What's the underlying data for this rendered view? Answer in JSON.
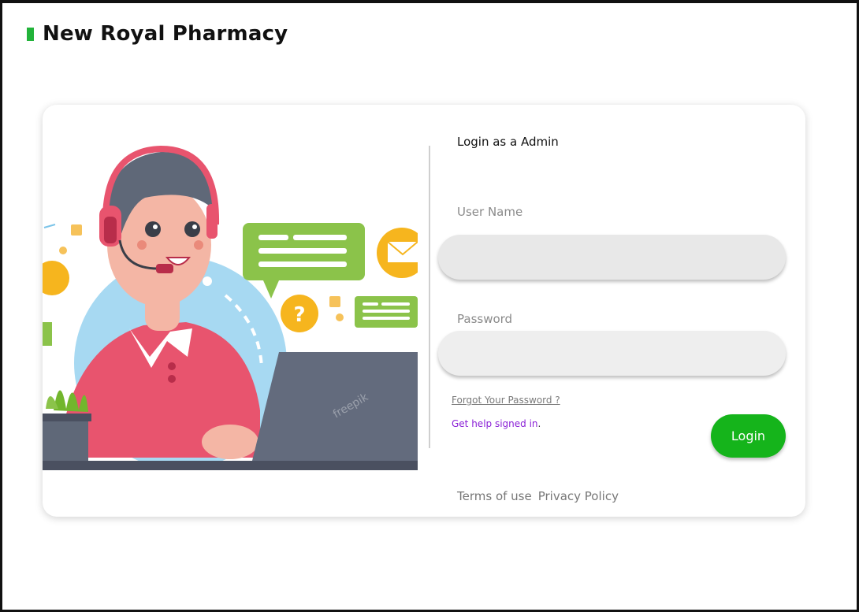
{
  "header": {
    "title": "New Royal Pharmacy"
  },
  "login": {
    "heading": "Login as a Admin",
    "username_label": "User Name",
    "username_value": "",
    "password_label": "Password",
    "password_value": "",
    "forgot_link": "Forgot  Your Password ?",
    "help_link": "Get help signed in",
    "help_suffix": ".",
    "submit_label": "Login"
  },
  "footer": {
    "terms": "Terms  of use",
    "privacy": "Privacy Policy"
  },
  "illustration": {
    "watermark": "freepik"
  },
  "colors": {
    "brand_green": "#22b33a",
    "login_button": "#15b41b",
    "help_link": "#8a1fd6",
    "input_bg": "#e8e8e8"
  }
}
